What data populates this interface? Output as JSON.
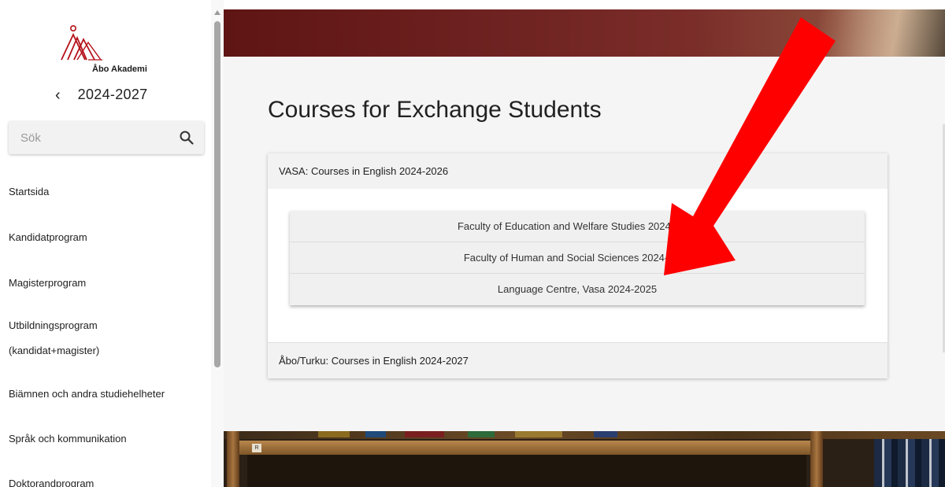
{
  "sidebar": {
    "logo_text": "Åbo Akademi",
    "year_back_icon": "chevron-left-icon",
    "year_label": "2024-2027",
    "search": {
      "placeholder": "Sök",
      "icon": "search-icon"
    },
    "nav_items": [
      "Startsida",
      "Kandidatprogram",
      "Magisterprogram",
      "Utbildningsprogram",
      "(kandidat+magister)",
      "Biämnen och andra studiehelheter",
      "Språk och kommunikation",
      "Doktorandprogram"
    ]
  },
  "main": {
    "title": "Courses for Exchange Students",
    "sections": [
      {
        "title": "VASA: Courses in English 2024-2026",
        "items": [
          "Faculty of Education and Welfare Studies 2024-2025",
          "Faculty of Human and Social Sciences 2024-2025",
          "Language Centre, Vasa 2024-2025"
        ]
      },
      {
        "title": "Åbo/Turku: Courses in English 2024-2027"
      }
    ],
    "shelf_label": "R"
  },
  "colors": {
    "banner": "#6d2120",
    "content_bg": "#f5f5f5",
    "arrow": "#ff0000"
  }
}
